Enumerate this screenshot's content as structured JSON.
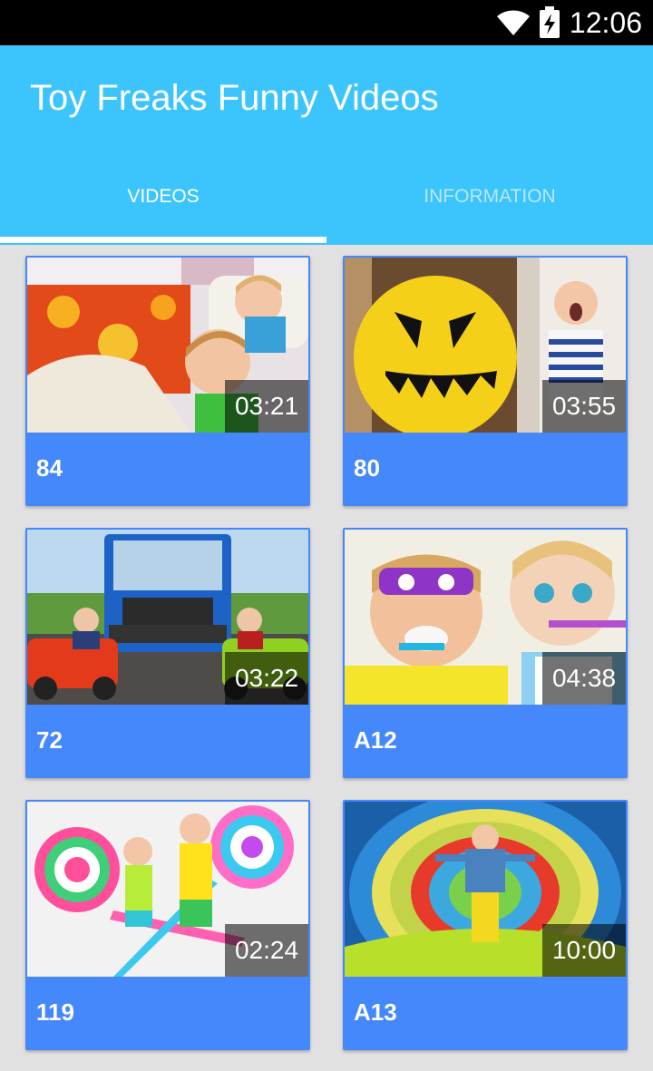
{
  "status_bar": {
    "time": "12:06",
    "wifi_icon": "wifi-icon",
    "battery_icon": "battery-charging-icon"
  },
  "app": {
    "title": "Toy Freaks Funny Videos"
  },
  "tabs": [
    {
      "label": "VIDEOS",
      "selected": true
    },
    {
      "label": "INFORMATION",
      "selected": false
    }
  ],
  "videos": [
    {
      "title": "84",
      "duration": "03:21"
    },
    {
      "title": "80",
      "duration": "03:55"
    },
    {
      "title": "72",
      "duration": "03:22"
    },
    {
      "title": "A12",
      "duration": "04:38"
    },
    {
      "title": "119",
      "duration": "02:24"
    },
    {
      "title": "A13",
      "duration": "10:00"
    }
  ],
  "colors": {
    "app_bar": "#3cc4fd",
    "card": "#4488fb",
    "background": "#e1e1e1"
  }
}
